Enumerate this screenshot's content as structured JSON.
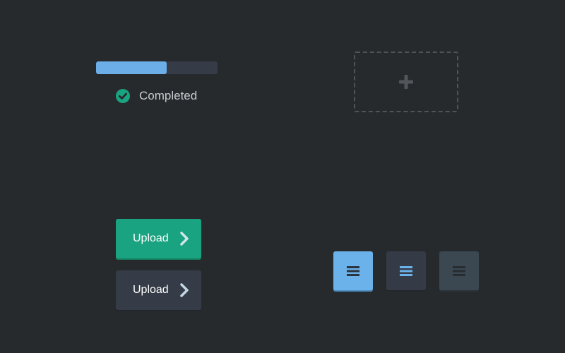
{
  "progress": {
    "value_percent": 58,
    "track_color": "#353c48",
    "fill_color": "#6caee8"
  },
  "status": {
    "label": "Completed",
    "icon": "check-circle-icon",
    "icon_color": "#1aa380"
  },
  "dropzone": {
    "icon": "plus-icon"
  },
  "upload_buttons": [
    {
      "label": "Upload",
      "icon": "chevron-right-icon",
      "color": "#1aa380"
    },
    {
      "label": "Upload",
      "icon": "chevron-right-icon",
      "color": "#353c48"
    }
  ],
  "menu_buttons": [
    {
      "icon": "hamburger-menu-icon",
      "bg": "#6cb2ea",
      "icon_color": "#2b3540"
    },
    {
      "icon": "hamburger-menu-icon",
      "bg": "#343b47",
      "icon_color": "#6cb2ea"
    },
    {
      "icon": "hamburger-menu-icon",
      "bg": "#3b4852",
      "icon_color": "#272c31"
    }
  ]
}
